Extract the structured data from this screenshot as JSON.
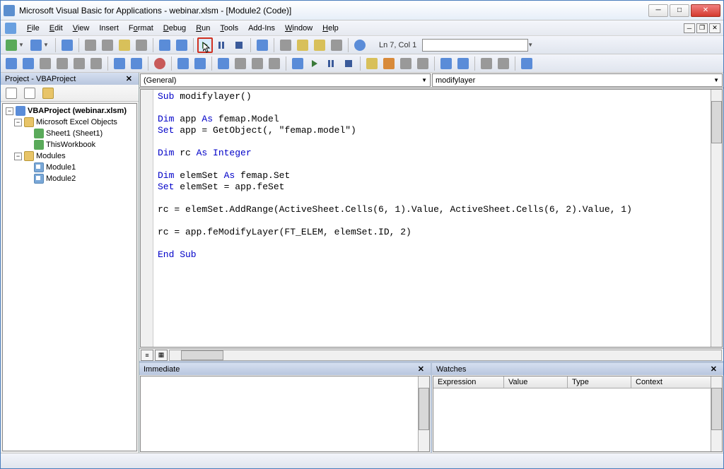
{
  "window": {
    "title": "Microsoft Visual Basic for Applications - webinar.xlsm - [Module2 (Code)]"
  },
  "menu": {
    "file": "File",
    "edit": "Edit",
    "view": "View",
    "insert": "Insert",
    "format": "Format",
    "debug": "Debug",
    "run": "Run",
    "tools": "Tools",
    "addins": "Add-Ins",
    "window": "Window",
    "help": "Help"
  },
  "toolbar": {
    "cursor_pos": "Ln 7, Col 1"
  },
  "project_panel": {
    "title": "Project - VBAProject",
    "root": "VBAProject (webinar.xlsm)",
    "excel_objects": "Microsoft Excel Objects",
    "sheet1": "Sheet1 (Sheet1)",
    "thisworkbook": "ThisWorkbook",
    "modules": "Modules",
    "module1": "Module1",
    "module2": "Module2"
  },
  "code_dropdowns": {
    "left": "(General)",
    "right": "modifylayer"
  },
  "code": {
    "line1_kw": "Sub",
    "line1_rest": " modifylayer()",
    "line2": "",
    "line3_kw1": "Dim",
    "line3_mid": " app ",
    "line3_kw2": "As",
    "line3_rest": " femap.Model",
    "line4_kw": "Set",
    "line4_rest": " app = GetObject(, \"femap.model\")",
    "line5": "",
    "line6_kw1": "Dim",
    "line6_mid": " rc ",
    "line6_kw2": "As Integer",
    "line7": "",
    "line8_kw1": "Dim",
    "line8_mid": " elemSet ",
    "line8_kw2": "As",
    "line8_rest": " femap.Set",
    "line9_kw": "Set",
    "line9_rest": " elemSet = app.feSet",
    "line10": "",
    "line11": "rc = elemSet.AddRange(ActiveSheet.Cells(6, 1).Value, ActiveSheet.Cells(6, 2).Value, 1)",
    "line12": "",
    "line13": "rc = app.feModifyLayer(FT_ELEM, elemSet.ID, 2)",
    "line14": "",
    "line15_kw": "End Sub"
  },
  "immediate": {
    "title": "Immediate"
  },
  "watches": {
    "title": "Watches",
    "cols": {
      "expression": "Expression",
      "value": "Value",
      "type": "Type",
      "context": "Context"
    }
  }
}
